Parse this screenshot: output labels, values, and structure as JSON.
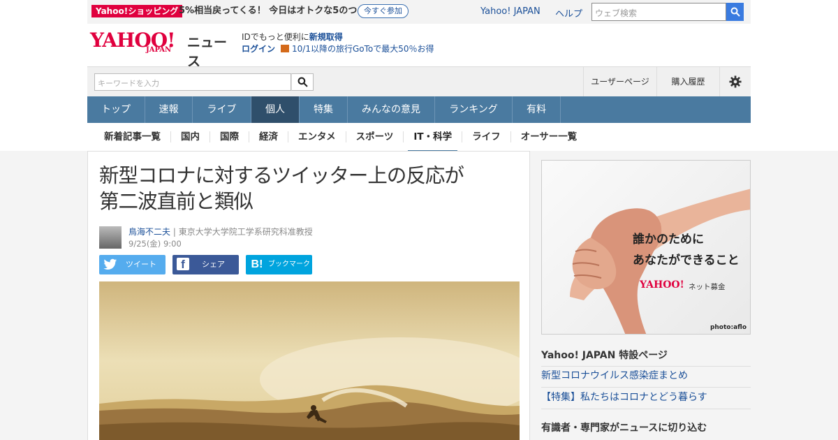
{
  "promo": {
    "badge": "Yahoo!ショッピング",
    "text": "5%相当戻ってくる！ 今日はオトクな5のつく日",
    "join_label": "今すぐ参加",
    "yahoo_japan": "Yahoo! JAPAN",
    "help": "ヘルプ",
    "web_search_placeholder": "ウェブ検索"
  },
  "header": {
    "logo_text": "YAHOO!",
    "logo_sub": "JAPAN",
    "section": "ニュース",
    "id_text": "IDでもっと便利に",
    "register": "新規取得",
    "login": "ログイン",
    "goto": "10/1以降の旅行GoToで最大50％お得"
  },
  "search": {
    "placeholder": "キーワードを入力",
    "user_page": "ユーザーページ",
    "purchase_history": "購入履歴"
  },
  "nav": [
    "トップ",
    "速報",
    "ライブ",
    "個人",
    "特集",
    "みんなの意見",
    "ランキング",
    "有料"
  ],
  "subnav": [
    "新着記事一覧",
    "国内",
    "国際",
    "経済",
    "エンタメ",
    "スポーツ",
    "IT・科学",
    "ライフ",
    "オーサー一覧"
  ],
  "article": {
    "title_line1": "新型コロナに対するツイッター上の反応が",
    "title_line2": "第二波直前と類似",
    "author": "鳥海不二夫",
    "affiliation": "| 東京大学大学院工学系研究科准教授",
    "date": "9/25(金) 9:00",
    "share_tweet": "ツイート",
    "share_fb": "シェア",
    "share_hatena": "ブックマーク"
  },
  "ad": {
    "line1": "誰かのために",
    "line2": "あなたができること",
    "brand": "YAHOO!",
    "brand_sub": "ネット募金",
    "credit": "photo:aflo"
  },
  "sidebar": {
    "section1": "Yahoo! JAPAN 特設ページ",
    "links": [
      "新型コロナウイルス感染症まとめ",
      "【特集】私たちはコロナとどう暮らす"
    ],
    "section2": "有識者・専門家がニュースに切り込む"
  },
  "colors": {
    "accent": "#e0003e",
    "nav": "#4a7aa0",
    "nav_active": "#2f4f6b",
    "link": "#1a4f98"
  }
}
